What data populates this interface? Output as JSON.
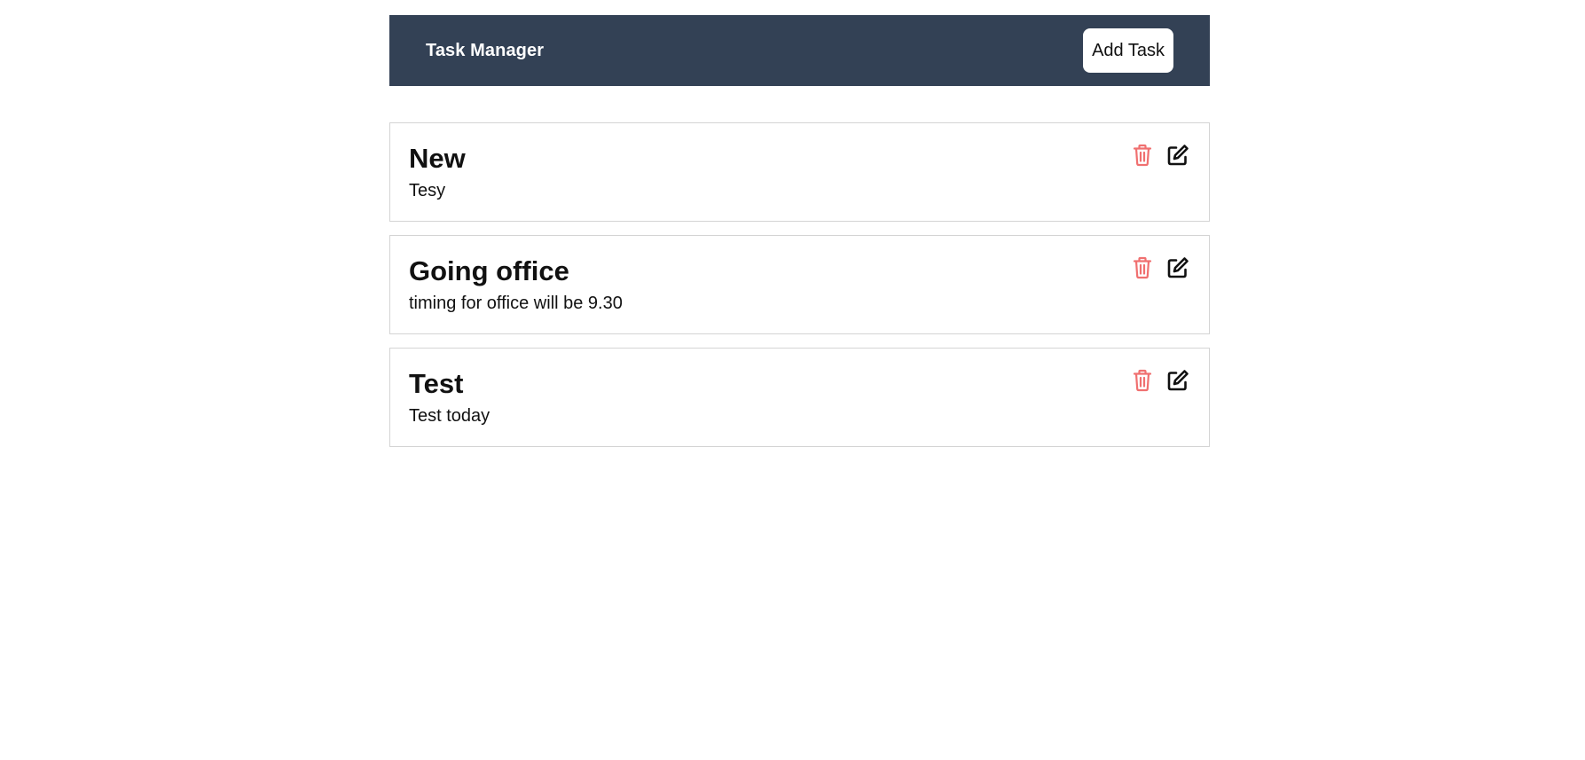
{
  "header": {
    "title": "Task Manager",
    "add_button_label": "Add Task"
  },
  "tasks": [
    {
      "title": "New",
      "description": "Tesy"
    },
    {
      "title": "Going office",
      "description": "timing for office will be 9.30"
    },
    {
      "title": "Test",
      "description": "Test today"
    }
  ],
  "icons": {
    "delete": "trash-icon",
    "edit": "edit-icon"
  },
  "colors": {
    "navbar": "#334155",
    "delete_icon": "#f07070",
    "edit_icon": "#111111",
    "card_border": "#d4d4d4"
  }
}
